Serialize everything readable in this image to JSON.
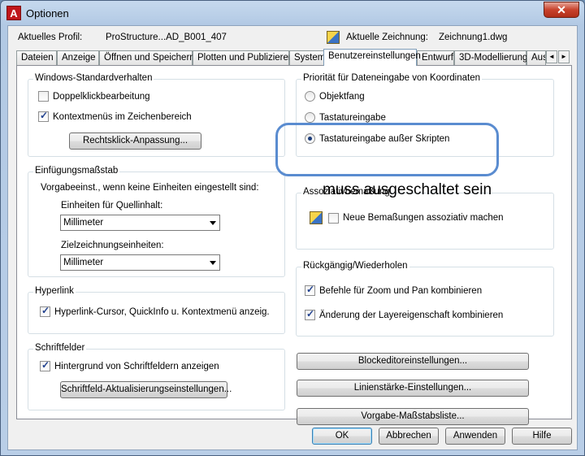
{
  "window": {
    "title": "Optionen",
    "app_icon": "A",
    "close_symbol": "✕"
  },
  "profile": {
    "label": "Aktuelles Profil:",
    "value": "ProStructure...AD_B001_407",
    "drawing_label": "Aktuelle Zeichnung:",
    "drawing_value": "Zeichnung1.dwg"
  },
  "tabs": [
    "Dateien",
    "Anzeige",
    "Öffnen und Speichern",
    "Plotten und Publizieren",
    "System",
    "Benutzereinstellungen",
    "Entwurf",
    "3D-Modellierung",
    "Aus"
  ],
  "tab_scroll": {
    "left": "◄",
    "right": "►"
  },
  "windows_std": {
    "title": "Windows-Standardverhalten",
    "double_click": {
      "label": "Doppelklickbearbeitung",
      "checked": false
    },
    "context_menus": {
      "label": "Kontextmenüs im Zeichenbereich",
      "checked": true
    },
    "right_click_button": "Rechtsklick-Anpassung..."
  },
  "insert_scale": {
    "title": "Einfügungsmaßstab",
    "note": "Vorgabeeinst., wenn keine Einheiten eingestellt sind:",
    "source_label": "Einheiten für Quellinhalt:",
    "source_value": "Millimeter",
    "target_label": "Zielzeichnungseinheiten:",
    "target_value": "Millimeter"
  },
  "hyperlink": {
    "title": "Hyperlink",
    "option": {
      "label": "Hyperlink-Cursor, QuickInfo u. Kontextmenü anzeig.",
      "checked": true
    }
  },
  "fields": {
    "title": "Schriftfelder",
    "option": {
      "label": "Hintergrund von Schriftfeldern anzeigen",
      "checked": true
    },
    "update_button": "Schriftfeld-Aktualisierungseinstellungen..."
  },
  "coord_priority": {
    "title": "Priorität für Dateneingabe von Koordinaten",
    "options": [
      {
        "label": "Objektfang",
        "checked": false
      },
      {
        "label": "Tastatureingabe",
        "checked": false
      },
      {
        "label": "Tastatureingabe außer Skripten",
        "checked": true
      }
    ]
  },
  "assoc_dim": {
    "title": "Assoziativbemaßung",
    "option": {
      "label": "Neue Bemaßungen assoziativ machen",
      "checked": false
    }
  },
  "annotation": "muss ausgeschaltet sein",
  "undo_redo": {
    "title": "Rückgängig/Wiederholen",
    "options": [
      {
        "label": "Befehle für Zoom und Pan kombinieren",
        "checked": true
      },
      {
        "label": "Änderung der Layereigenschaft kombinieren",
        "checked": true
      }
    ]
  },
  "side_buttons": [
    "Blockeditoreinstellungen...",
    "Linienstärke-Einstellungen...",
    "Vorgabe-Maßstabsliste..."
  ],
  "dialog_buttons": {
    "ok": "OK",
    "cancel": "Abbrechen",
    "apply": "Anwenden",
    "help": "Hilfe"
  },
  "colors": {
    "highlight_ring": "#5a8cd0",
    "title_bar": "#b9cee7",
    "close_button": "#c8422c"
  }
}
